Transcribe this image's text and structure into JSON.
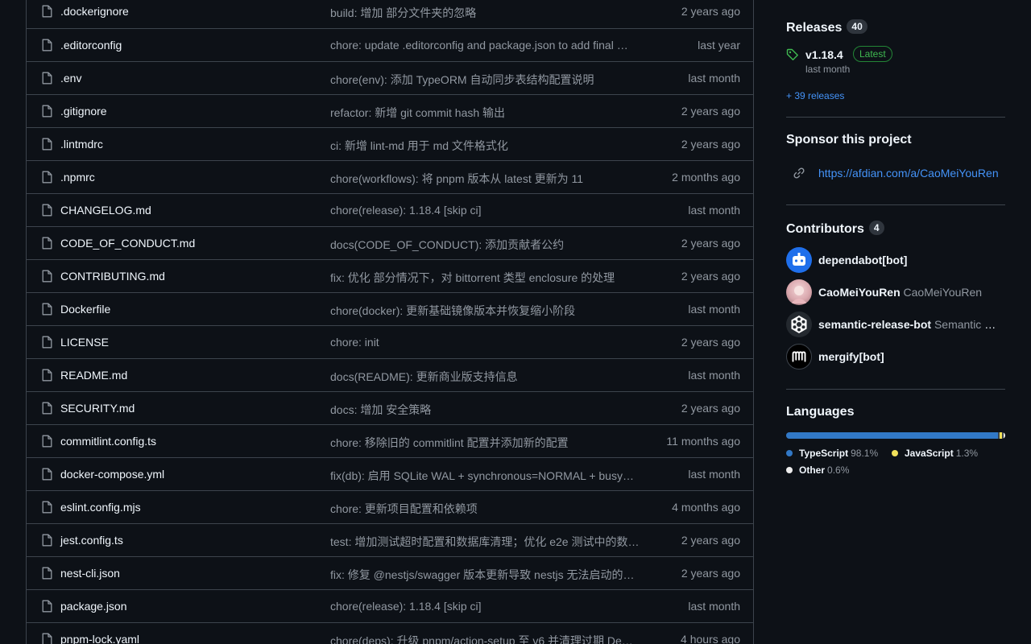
{
  "files": [
    {
      "name": ".dockerignore",
      "message": "build: 增加 部分文件夹的忽略",
      "age": "2 years ago"
    },
    {
      "name": ".editorconfig",
      "message": "chore: update .editorconfig and package.json to add final …",
      "age": "last year"
    },
    {
      "name": ".env",
      "message": "chore(env): 添加 TypeORM 自动同步表结构配置说明",
      "age": "last month"
    },
    {
      "name": ".gitignore",
      "message": "refactor: 新增 git commit hash 输出",
      "age": "2 years ago"
    },
    {
      "name": ".lintmdrc",
      "message": "ci: 新增 lint-md 用于 md 文件格式化",
      "age": "2 years ago"
    },
    {
      "name": ".npmrc",
      "message": "chore(workflows): 将 pnpm 版本从 latest 更新为 11",
      "age": "2 months ago"
    },
    {
      "name": "CHANGELOG.md",
      "message": "chore(release): 1.18.4 [skip ci]",
      "age": "last month"
    },
    {
      "name": "CODE_OF_CONDUCT.md",
      "message": "docs(CODE_OF_CONDUCT): 添加贡献者公约",
      "age": "2 years ago"
    },
    {
      "name": "CONTRIBUTING.md",
      "message": "fix: 优化 部分情况下，对 bittorrent 类型 enclosure 的处理",
      "age": "2 years ago"
    },
    {
      "name": "Dockerfile",
      "message": "chore(docker): 更新基础镜像版本并恢复缩小阶段",
      "age": "last month"
    },
    {
      "name": "LICENSE",
      "message": "chore: init",
      "age": "2 years ago"
    },
    {
      "name": "README.md",
      "message": "docs(README): 更新商业版支持信息",
      "age": "last month"
    },
    {
      "name": "SECURITY.md",
      "message": "docs: 增加 安全策略",
      "age": "2 years ago"
    },
    {
      "name": "commitlint.config.ts",
      "message": "chore: 移除旧的 commitlint 配置并添加新的配置",
      "age": "11 months ago"
    },
    {
      "name": "docker-compose.yml",
      "message": "fix(db): 启用 SQLite WAL + synchronous=NORMAL + busy…",
      "age": "last month"
    },
    {
      "name": "eslint.config.mjs",
      "message": "chore: 更新项目配置和依赖项",
      "age": "4 months ago"
    },
    {
      "name": "jest.config.ts",
      "message": "test: 增加测试超时配置和数据库清理；优化 e2e 测试中的数…",
      "age": "2 years ago"
    },
    {
      "name": "nest-cli.json",
      "message": "fix: 修复 @nestjs/swagger 版本更新导致 nestjs 无法启动的…",
      "age": "2 years ago"
    },
    {
      "name": "package.json",
      "message": "chore(release): 1.18.4 [skip ci]",
      "age": "last month"
    },
    {
      "name": "pnpm-lock.yaml",
      "message": "chore(deps): 升级 pnpm/action-setup 至 v6 并清理过期 De…",
      "age": "4 hours ago"
    }
  ],
  "releases": {
    "title": "Releases",
    "count": "40",
    "version": "v1.18.4",
    "badge": "Latest",
    "date": "last month",
    "more": "+ 39 releases"
  },
  "sponsor": {
    "title": "Sponsor this project",
    "link": "https://afdian.com/a/CaoMeiYouRen"
  },
  "contributors": {
    "title": "Contributors",
    "count": "4",
    "items": [
      {
        "login": "dependabot[bot]",
        "name": ""
      },
      {
        "login": "CaoMeiYouRen",
        "name": "CaoMeiYouRen"
      },
      {
        "login": "semantic-release-bot",
        "name": "Semantic Release Bot"
      },
      {
        "login": "mergify[bot]",
        "name": ""
      }
    ]
  },
  "languages": {
    "title": "Languages",
    "items": [
      {
        "name": "TypeScript",
        "percent": "98.1%",
        "value": 98.1,
        "color": "#3178c6"
      },
      {
        "name": "JavaScript",
        "percent": "1.3%",
        "value": 1.3,
        "color": "#f1e05a"
      },
      {
        "name": "Other",
        "percent": "0.6%",
        "value": 0.6,
        "color": "#ededed"
      }
    ]
  }
}
